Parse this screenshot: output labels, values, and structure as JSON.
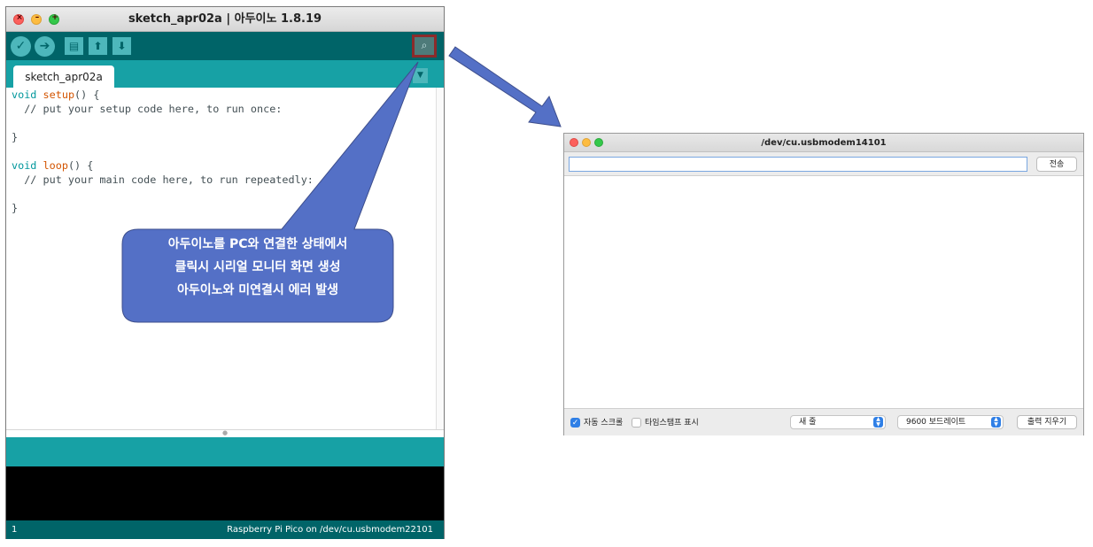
{
  "ide": {
    "title": "sketch_apr02a | 아두이노 1.8.19",
    "toolbar": {
      "verify_icon": "check-icon",
      "upload_icon": "arrow-right-icon",
      "new_icon": "document-icon",
      "open_icon": "arrow-up-icon",
      "save_icon": "arrow-down-icon",
      "serial_monitor_icon": "magnifier-icon"
    },
    "tab": {
      "label": "sketch_apr02a"
    },
    "code": {
      "line1_kw": "void",
      "line1_fn": "setup",
      "line1_rest": "() {",
      "line2": "  // put your setup code here, to run once:",
      "line4": "}",
      "line6_kw": "void",
      "line6_fn": "loop",
      "line6_rest": "() {",
      "line7": "  // put your main code here, to run repeatedly:",
      "line9": "}"
    },
    "status": {
      "line_number": "1",
      "board": "Raspberry Pi Pico on /dev/cu.usbmodem22101"
    },
    "colors": {
      "toolbar": "#006468",
      "tabbar": "#17a1a5"
    }
  },
  "callout": {
    "lines": [
      "아두이노를 PC와 연결한 상태에서",
      "클릭시 시리얼 모니터 화면 생성",
      "아두이노와 미연결시 에러 발생"
    ],
    "color": "#5470c6"
  },
  "serial_monitor": {
    "title": "/dev/cu.usbmodem14101",
    "input": {
      "value": "",
      "placeholder": ""
    },
    "send_label": "전송",
    "autoscroll_label": "자동 스크롤",
    "autoscroll_checked": true,
    "timestamp_label": "타임스탬프 표시",
    "timestamp_checked": false,
    "line_ending": "새 줄",
    "baud_rate": "9600 보드레이트",
    "clear_label": "출력 지우기"
  }
}
